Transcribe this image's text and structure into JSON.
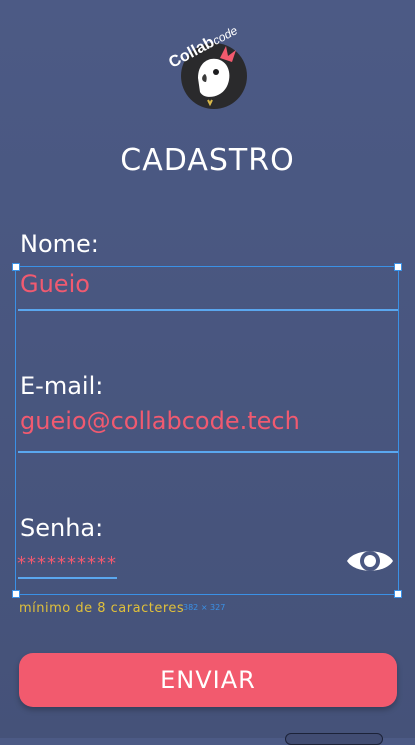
{
  "brand": {
    "logo_main": "Collab",
    "logo_sub": "code"
  },
  "form": {
    "title": "CADASTRO",
    "name_label": "Nome:",
    "name_value": "Gueio",
    "email_label": "E-mail:",
    "email_value": "gueio@collabcode.tech",
    "password_label": "Senha:",
    "password_value": "**********",
    "password_hint": "mínimo de 8 caracteres",
    "submit_label": "ENVIAR"
  },
  "colors": {
    "background": "#4c5a85",
    "accent": "#f25a6e",
    "input_text": "#f05a70",
    "underline": "#5aa7ef",
    "hint": "#e0c03a"
  },
  "icons": {
    "logo": "cockatoo-logo-icon",
    "toggle_password": "eye-icon"
  }
}
